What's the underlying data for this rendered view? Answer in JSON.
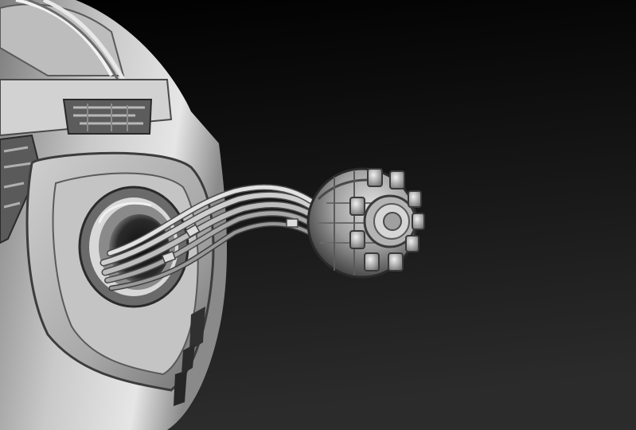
{
  "scene": {
    "subject": "sculpted-robot-head-with-cable-eye",
    "colors": {
      "background_top": "#000000",
      "background_bottom": "#2b2b2b",
      "metal_light": "#e4e4e4",
      "metal_mid": "#9a9a9a",
      "metal_dark": "#3a3a3a",
      "cavity": "#1e1e1e"
    }
  }
}
